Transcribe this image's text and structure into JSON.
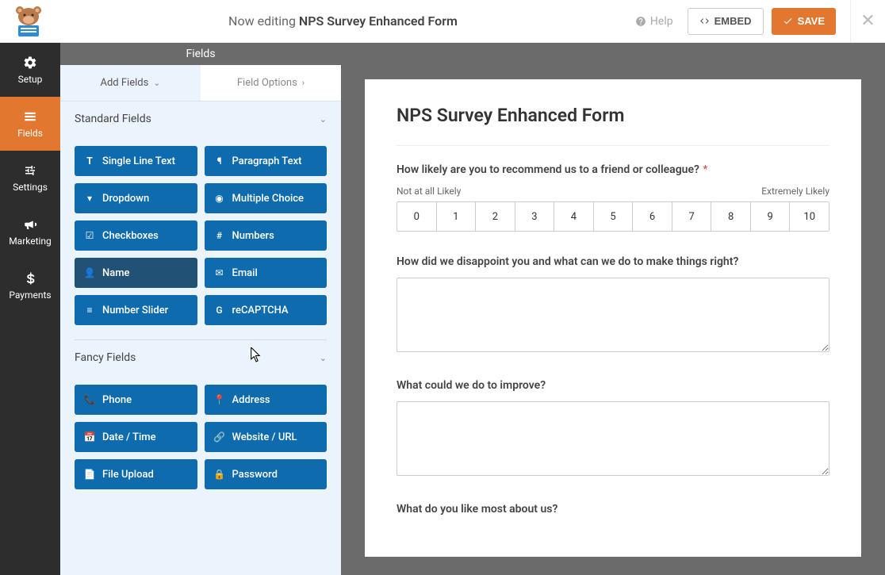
{
  "topbar": {
    "editing_prefix": "Now editing ",
    "form_name": "NPS Survey Enhanced Form",
    "help_label": "Help",
    "embed_label": "EMBED",
    "save_label": "SAVE"
  },
  "leftnav": {
    "items": [
      {
        "label": "Setup",
        "icon": "gear-icon"
      },
      {
        "label": "Fields",
        "icon": "list-icon"
      },
      {
        "label": "Settings",
        "icon": "sliders-icon"
      },
      {
        "label": "Marketing",
        "icon": "bullhorn-icon"
      },
      {
        "label": "Payments",
        "icon": "dollar-icon"
      }
    ]
  },
  "sidebar": {
    "header": "Fields",
    "tabs": {
      "add": "Add Fields",
      "options": "Field Options"
    },
    "groups": {
      "standard": {
        "title": "Standard Fields",
        "fields": [
          {
            "label": "Single Line Text",
            "icon": "text-icon"
          },
          {
            "label": "Paragraph Text",
            "icon": "paragraph-icon"
          },
          {
            "label": "Dropdown",
            "icon": "caret-square-icon"
          },
          {
            "label": "Multiple Choice",
            "icon": "dot-circle-icon"
          },
          {
            "label": "Checkboxes",
            "icon": "check-square-icon"
          },
          {
            "label": "Numbers",
            "icon": "hash-icon"
          },
          {
            "label": "Name",
            "icon": "user-icon"
          },
          {
            "label": "Email",
            "icon": "envelope-icon"
          },
          {
            "label": "Number Slider",
            "icon": "sliders-h-icon"
          },
          {
            "label": "reCAPTCHA",
            "icon": "google-g-icon"
          }
        ]
      },
      "fancy": {
        "title": "Fancy Fields",
        "fields": [
          {
            "label": "Phone",
            "icon": "phone-icon"
          },
          {
            "label": "Address",
            "icon": "map-marker-icon"
          },
          {
            "label": "Date / Time",
            "icon": "calendar-icon"
          },
          {
            "label": "Website / URL",
            "icon": "link-icon"
          },
          {
            "label": "File Upload",
            "icon": "file-icon"
          },
          {
            "label": "Password",
            "icon": "lock-icon"
          }
        ]
      }
    }
  },
  "preview": {
    "form_title": "NPS Survey Enhanced Form",
    "q1": {
      "label": "How likely are you to recommend us to a friend or colleague?",
      "required": true,
      "low_label": "Not at all Likely",
      "high_label": "Extremely Likely",
      "scale": [
        "0",
        "1",
        "2",
        "3",
        "4",
        "5",
        "6",
        "7",
        "8",
        "9",
        "10"
      ]
    },
    "q2": {
      "label": "How did we disappoint you and what can we do to make things right?"
    },
    "q3": {
      "label": "What could we do to improve?"
    },
    "q4": {
      "label": "What do you like most about us?"
    }
  }
}
